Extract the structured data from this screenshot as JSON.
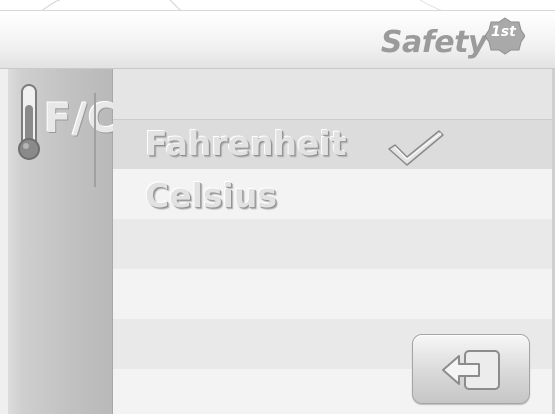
{
  "header": {
    "brand_name": "Safety",
    "brand_badge": "1st",
    "brand_color": "#9b9b9b"
  },
  "sidebar": {
    "icon": "thermometer-icon",
    "label": "F/C"
  },
  "options": [
    {
      "label": "Fahrenheit",
      "selected": true
    },
    {
      "label": "Celsius",
      "selected": false
    }
  ],
  "icons": {
    "selected_indicator": "checkmark-icon",
    "back_button": "back-arrow-icon"
  },
  "colors": {
    "text_embossed": "#e2e2e2",
    "text_shadow": "#8f8f8f",
    "sidebar": "#c2c2c2",
    "background": "#f3f3f3"
  }
}
